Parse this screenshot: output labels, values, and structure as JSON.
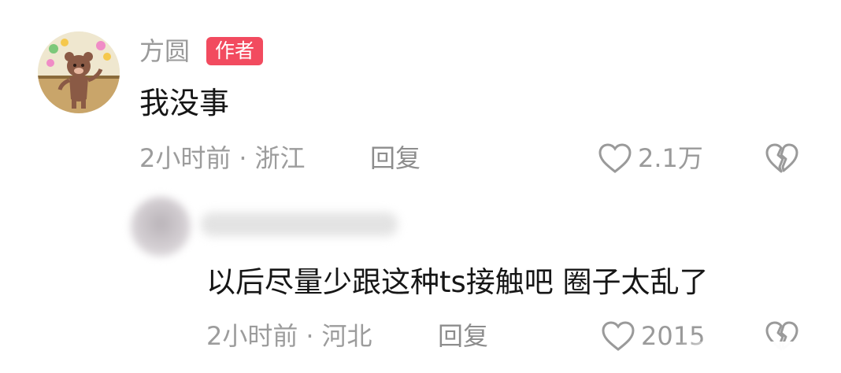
{
  "comment": {
    "author": "方圆",
    "badge": "作者",
    "text": "我没事",
    "time": "2小时前",
    "location": "浙江",
    "reply_label": "回复",
    "likes": "2.1万",
    "icons": [
      "avatar",
      "heart-icon",
      "broken-heart-icon"
    ]
  },
  "reply": {
    "text": "以后尽量少跟这种ts接触吧 圈子太乱了",
    "time": "2小时前",
    "location": "河北",
    "reply_label": "回复",
    "likes": "2015",
    "icons": [
      "avatar",
      "heart-icon",
      "broken-heart-icon"
    ]
  },
  "colors": {
    "badge": "#f24b5f",
    "meta_text": "#9c9c9c",
    "body_text": "#161616"
  }
}
